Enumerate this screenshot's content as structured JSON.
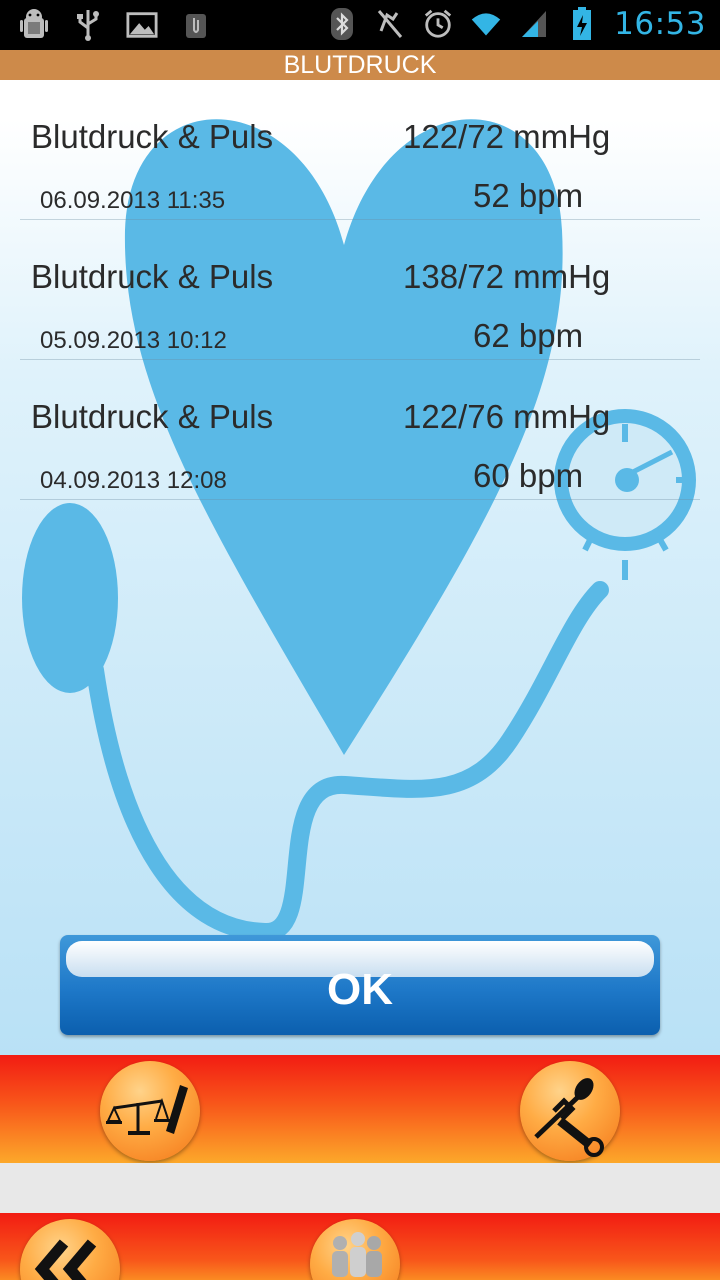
{
  "status_bar": {
    "time": "16:53",
    "icons": [
      "android-debug-icon",
      "usb-icon",
      "image-icon",
      "clipboard-icon",
      "bluetooth-icon",
      "mute-icon",
      "alarm-icon",
      "wifi-icon",
      "signal-icon",
      "battery-charging-icon"
    ]
  },
  "header": {
    "title": "BLUTDRUCK"
  },
  "readings": [
    {
      "title": "Blutdruck & Puls",
      "date": "06.09.2013 11:35",
      "bp": "122/72 mmHg",
      "pulse": "52 bpm"
    },
    {
      "title": "Blutdruck & Puls",
      "date": "05.09.2013 10:12",
      "bp": "138/72 mmHg",
      "pulse": "62 bpm"
    },
    {
      "title": "Blutdruck & Puls",
      "date": "04.09.2013 12:08",
      "bp": "122/76 mmHg",
      "pulse": "60 bpm"
    }
  ],
  "ok_button": {
    "label": "OK"
  },
  "bottom_nav": {
    "row1": [
      "scale-ruler-icon",
      "tools-icon"
    ],
    "row2": [
      "back-double-chevron-icon",
      "people-icon"
    ]
  },
  "colors": {
    "title_bar": "#cd8a4a",
    "heart": "#5ab9e6",
    "ok_button": "#1e78c8",
    "nav_bar": "#f21c13",
    "clock": "#33b5e5"
  }
}
